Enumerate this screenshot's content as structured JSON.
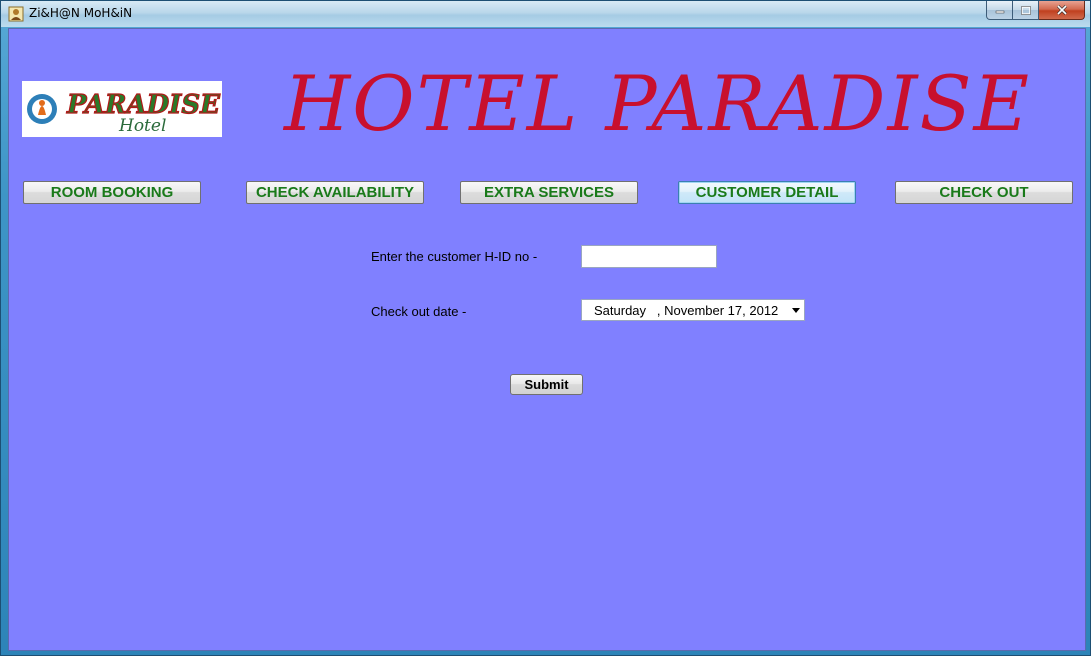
{
  "window": {
    "title": "Zi&H@N MoH&iN",
    "app_icon": "user-icon",
    "controls": {
      "minimize": "minimize-icon",
      "maximize": "maximize-icon",
      "close": "close-icon"
    }
  },
  "header": {
    "logo": {
      "name": "paradise-hotel-logo",
      "brand_text": "PARADISE",
      "sub_text": "Hotel"
    },
    "headline": "HOTEL PARADISE"
  },
  "nav": {
    "room_booking": "ROOM BOOKING",
    "check_availability": "CHECK AVAILABILITY",
    "extra_services": "EXTRA SERVICES",
    "customer_detail": "CUSTOMER DETAIL",
    "check_out": "CHECK OUT"
  },
  "form": {
    "hid_label": "Enter the customer H-ID no -",
    "hid_value": "",
    "checkout_label": "Check out date -",
    "checkout_value": "Saturday   , November 17, 2012",
    "submit_label": "Submit"
  },
  "colors": {
    "background": "#8080ff",
    "headline": "#c8102e",
    "nav_text": "#1a7a1a"
  }
}
